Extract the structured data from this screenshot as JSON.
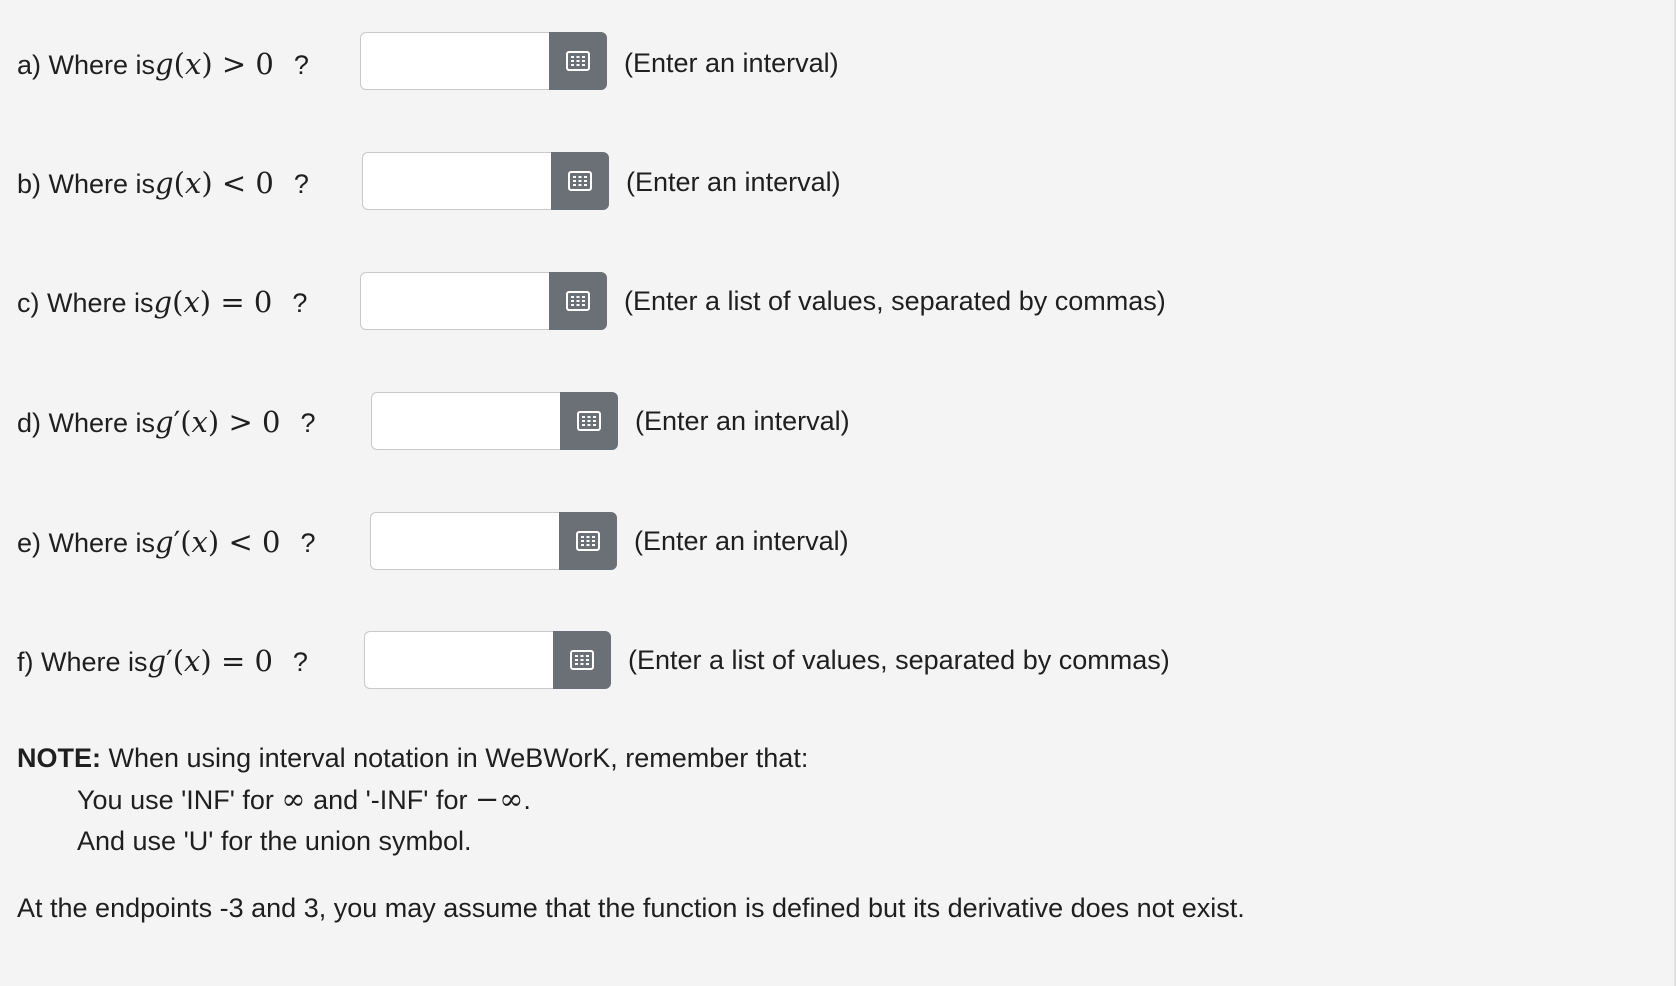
{
  "questions": [
    {
      "label": "a) Where is ",
      "fn": "g",
      "prime": "",
      "op": ">",
      "rhs": "0",
      "qmark": "?",
      "value": "",
      "hint": "(Enter an interval)"
    },
    {
      "label": "b) Where is ",
      "fn": "g",
      "prime": "",
      "op": "<",
      "rhs": "0",
      "qmark": "?",
      "value": "",
      "hint": "(Enter an interval)"
    },
    {
      "label": "c) Where is ",
      "fn": "g",
      "prime": "",
      "op": "=",
      "rhs": "0",
      "qmark": "?",
      "value": "",
      "hint": "(Enter a list of values, separated by commas)"
    },
    {
      "label": "d) Where is ",
      "fn": "g",
      "prime": "′",
      "op": ">",
      "rhs": "0",
      "qmark": "?",
      "value": "",
      "hint": "(Enter an interval)"
    },
    {
      "label": "e) Where is ",
      "fn": "g",
      "prime": "′",
      "op": "<",
      "rhs": "0",
      "qmark": "?",
      "value": "",
      "hint": "(Enter an interval)"
    },
    {
      "label": "f) Where is ",
      "fn": "g",
      "prime": "′",
      "op": "=",
      "rhs": "0",
      "qmark": "?",
      "value": "",
      "hint": "(Enter a list of values, separated by commas)"
    }
  ],
  "math_button_icon": "grid-keypad-icon",
  "note": {
    "bold": "NOTE:",
    "line1": " When using interval notation in WeBWorK, remember that:",
    "line2_a": "You use 'INF' for ",
    "line2_inf": "∞",
    "line2_b": " and '-INF' for ",
    "line2_neginf": "−∞",
    "line2_c": ".",
    "line3": "And use 'U' for the union symbol."
  },
  "footer": "At the endpoints -3 and 3, you may assume that the function is defined but its derivative does not exist.",
  "colors": {
    "background": "#f4f4f4",
    "button": "#6b7077",
    "text": "#1f1f1f"
  }
}
